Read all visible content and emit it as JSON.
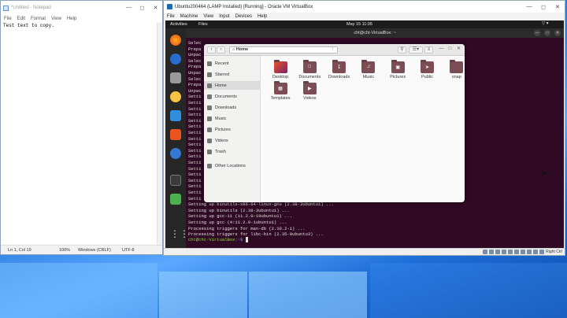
{
  "notepad": {
    "title": "*Untitled - Notepad",
    "menu": [
      "File",
      "Edit",
      "Format",
      "View",
      "Help"
    ],
    "content": "Test text to copy.",
    "status": {
      "position": "Ln 1, Col 19",
      "zoom": "100%",
      "line_ending": "Windows (CRLF)",
      "encoding": "UTF-8"
    }
  },
  "vbox": {
    "title": "Ubuntu200464 (LAMP Installed) [Running] - Oracle VM VirtualBox",
    "menu": [
      "File",
      "Machine",
      "View",
      "Input",
      "Devices",
      "Help"
    ],
    "host_key": "Right Ctrl"
  },
  "ubuntu": {
    "activities": "Activities",
    "app_menu": "Files",
    "clock": "May 15  11:05",
    "terminal_title": "cht@cht-VirtualBox: ~",
    "terminal_lines": [
      "Selec",
      "Prepa",
      "Unpac",
      "Selec",
      "Prepa",
      "Unpac",
      "Selec",
      "Prepa",
      "Unpac",
      "Setti",
      "Setti",
      "Setti",
      "Setti",
      "Setti",
      "Setti",
      "Setti",
      "Setti",
      "Setti",
      "Setti",
      "Setti",
      "Setti",
      "Setti",
      "Setti",
      "Setti",
      "Setti",
      "Setti",
      "Setti",
      "Setting up binutils-x86-64-linux-gnu (2.38-3ubuntu1) ...",
      "Setting up binutils (2.38-3ubuntu1) ...",
      "Setting up gcc-11 (11.2.0-19ubuntu1) ...",
      "Setting up gcc (4:11.2.0-1ubuntu1) ...",
      "Processing triggers for man-db (2.10.2-1) ...",
      "Processing triggers for libc-bin (2.35-0ubuntu3) ..."
    ],
    "prompt_user": "cht@cht-VirtualBox",
    "prompt_path": ":~$",
    "files": {
      "path_label": "Home",
      "sidebar": [
        "Recent",
        "Starred",
        "Home",
        "Documents",
        "Downloads",
        "Music",
        "Pictures",
        "Videos",
        "Trash",
        "Other Locations"
      ],
      "folders": [
        "Desktop",
        "Documents",
        "Downloads",
        "Music",
        "Pictures",
        "Public",
        "snap",
        "Templates",
        "Videos"
      ]
    }
  },
  "colors": {
    "terminal_bg": "#300a24",
    "ubuntu_orange": "#e95420",
    "folder": "#7d4d56",
    "win_blue": "#1f6fd8"
  }
}
